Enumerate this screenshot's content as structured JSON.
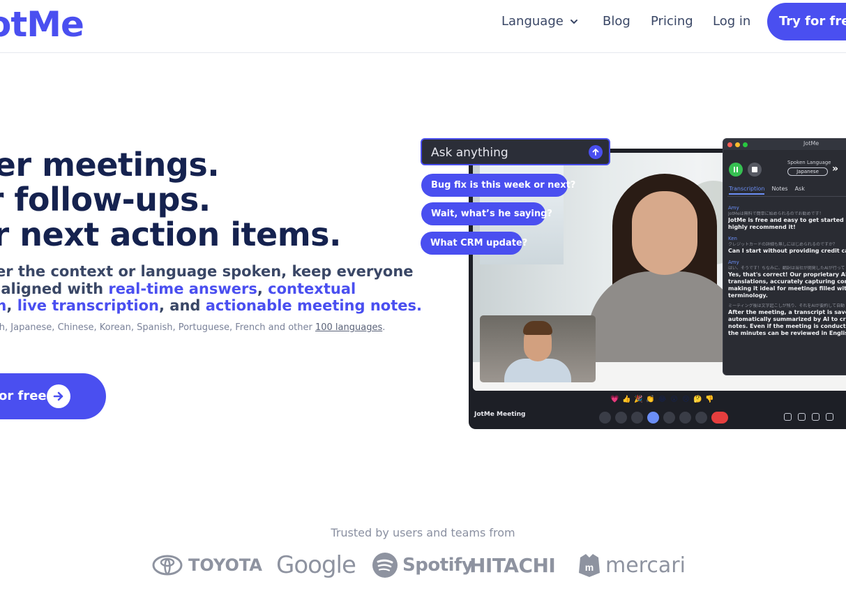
{
  "header": {
    "logo": "otMe",
    "nav": {
      "language": "Language",
      "blog": "Blog",
      "pricing": "Pricing",
      "login": "Log in"
    },
    "cta": "Try for free"
  },
  "hero": {
    "headline": [
      "rter meetings.",
      "er follow-ups.",
      "ar next action items."
    ],
    "sub": {
      "line1": "er the context or language spoken, keep everyone",
      "line2_a": "t aligned with ",
      "line2_b": "real-time answers",
      "line2_c": ", ",
      "line2_d": "contextual",
      "line3_a": "on",
      "line3_b": ", ",
      "line3_c": "live transcription",
      "line3_d": ", and ",
      "line3_e": "actionable meeting notes",
      "line3_f": "."
    },
    "languages_prefix": "sh, Japanese, Chinese, Korean, Spanish, Portuguese, French and other ",
    "languages_link": "100 languages",
    "languages_suffix": ".",
    "cta": "or free"
  },
  "mockup": {
    "ask_placeholder": "Ask anything",
    "chips": [
      "Bug fix is this week or next?",
      "Wait, what’s he saying?",
      "What CRM update?"
    ],
    "meeting_title": "JotMe Meeting",
    "reactions": [
      "💗",
      "👍",
      "🎉",
      "👏",
      "😂",
      "😮",
      "😢",
      "🤔",
      "👎"
    ],
    "panel": {
      "title": "JotMe",
      "spoken_language_label": "Spoken Language",
      "spoken_language_value": "Japanese",
      "tabs": [
        "Transcription",
        "Notes",
        "Ask"
      ],
      "entries": [
        {
          "name": "Amy",
          "jp": "JotMeは無料で簡単に始められるのでお勧めです！",
          "en": [
            "JotMe is free and easy to get started wit",
            "highly recommend it!"
          ]
        },
        {
          "name": "Ken",
          "jp": "クレジットカードの詳細も無しにはじめられるのですか？",
          "en": [
            "Can I start without providing credit card"
          ]
        },
        {
          "name": "Amy",
          "jp": "はい、そうです！ちなみに、翻訳は当社が開発したAIが行って",
          "en": [
            "Yes, that's correct! Our proprietary AI ha",
            "translations, accurately capturing contex",
            "making it ideal for meetings filled with te",
            "terminology."
          ]
        },
        {
          "name": "",
          "jp": "ミーティング後は文字起こしが残り、それをAIが要約して自動",
          "en": [
            "After the meeting, a transcript is saved a",
            "automatically summarized by AI to creat",
            "notes. Even if the meeting is conducted i",
            "the minutes can be reviewed in English."
          ]
        }
      ]
    }
  },
  "trusted": {
    "label": "Trusted by users and teams from",
    "logos": [
      "TOYOTA",
      "Google",
      "Spotify",
      "HITACHI",
      "mercari"
    ]
  },
  "colors": {
    "brand": "#4a4ff0",
    "heading": "#15224f",
    "text": "#3a4766",
    "muted": "#8a90a1"
  }
}
